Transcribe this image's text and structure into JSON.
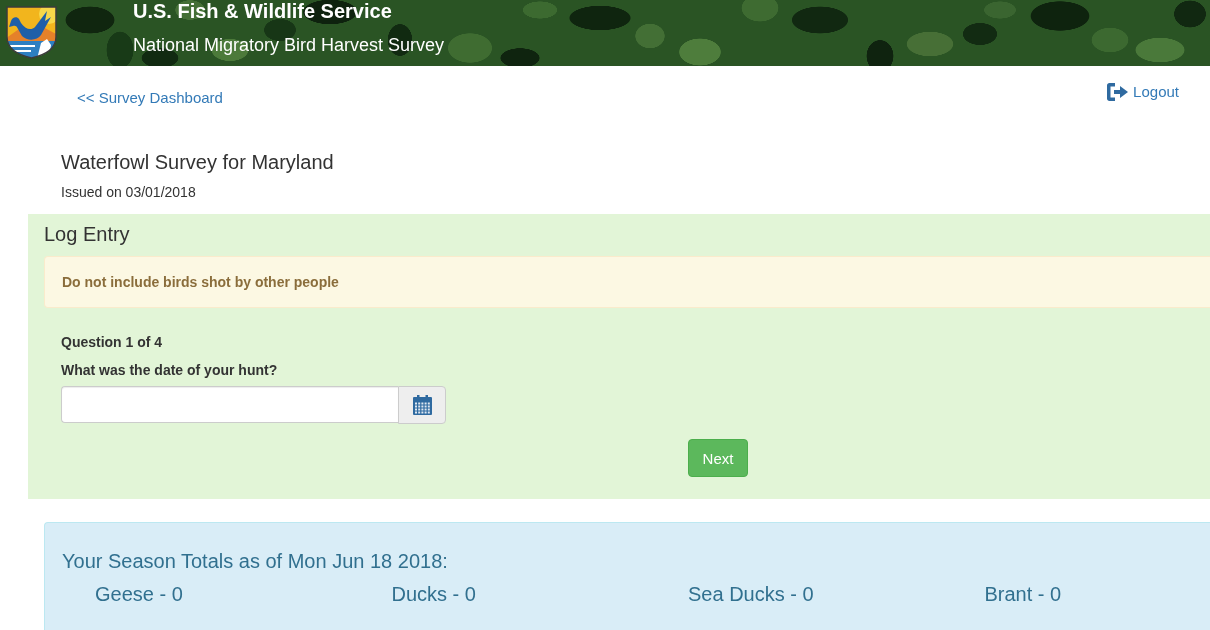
{
  "header": {
    "agency": "U.S. Fish & Wildlife Service",
    "subtitle": "National Migratory Bird Harvest Survey"
  },
  "nav": {
    "back_link": "<< Survey Dashboard",
    "logout": "Logout"
  },
  "survey": {
    "title": "Waterfowl Survey for Maryland",
    "issued": "Issued on 03/01/2018"
  },
  "log_entry": {
    "title": "Log Entry",
    "alert": "Do not include birds shot by other people",
    "question_number": "Question 1 of 4",
    "question": "What was the date of your hunt?",
    "next_button": "Next"
  },
  "season_totals": {
    "title": "Your Season Totals as of Mon Jun 18 2018:",
    "items": [
      "Geese - 0",
      "Ducks - 0",
      "Sea Ducks - 0",
      "Brant - 0"
    ]
  }
}
